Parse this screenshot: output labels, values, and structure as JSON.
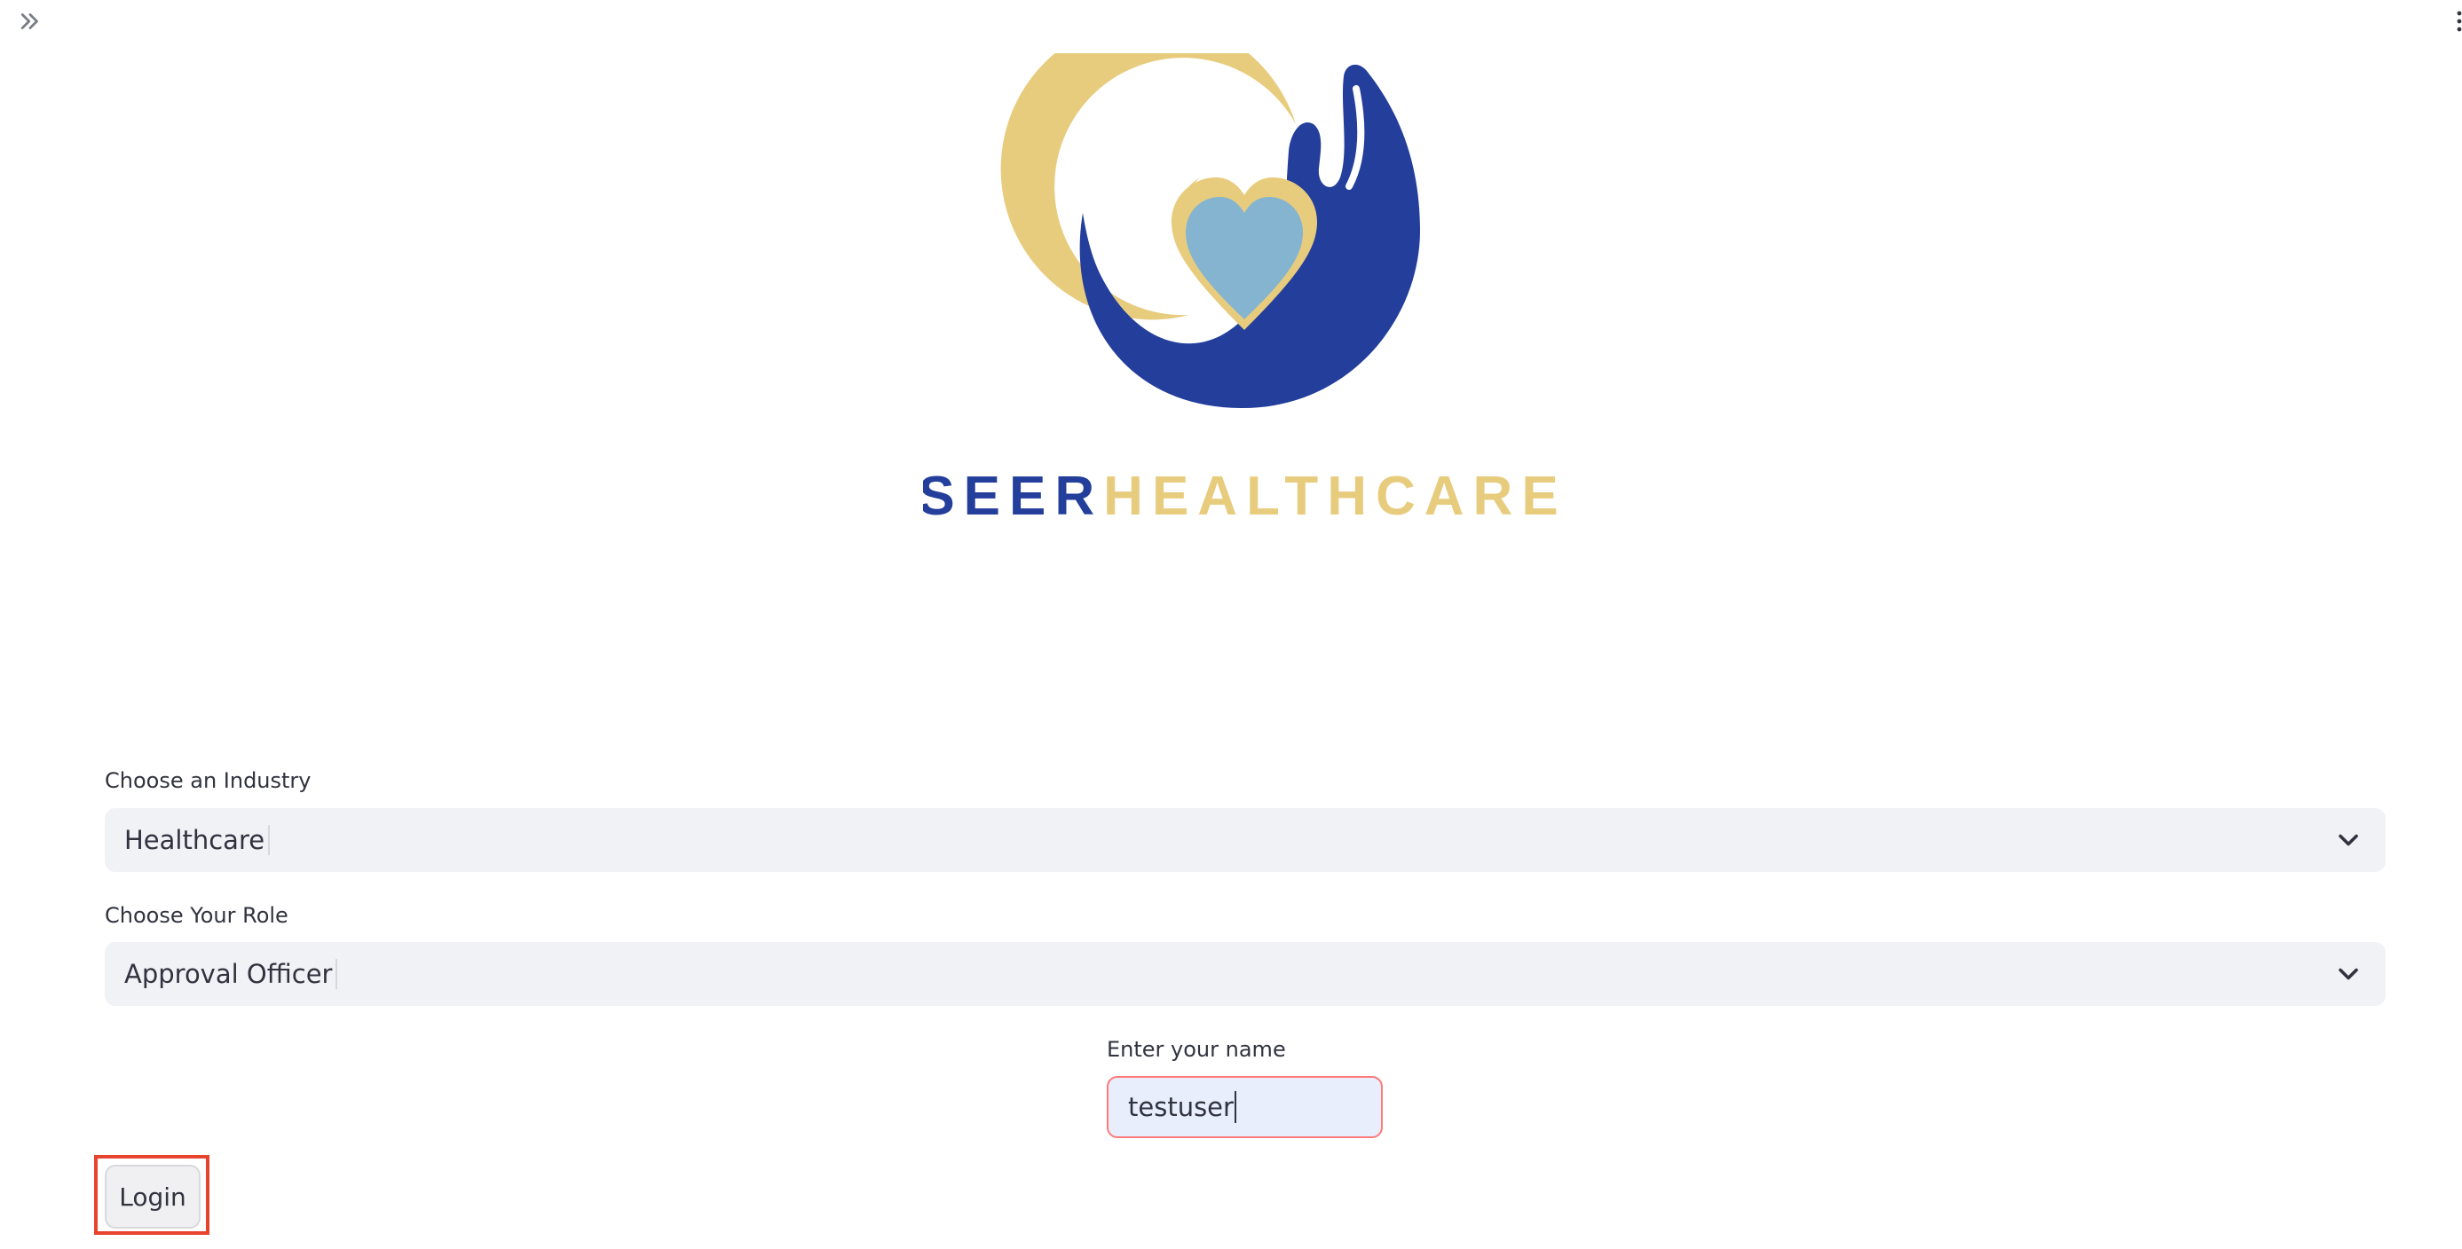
{
  "toolbar": {
    "expand_icon": "chevrons-right-icon",
    "menu_icon": "vertical-dots-icon"
  },
  "logo": {
    "brand_part1": "SEER",
    "brand_part2": "HEALTHCARE",
    "colors": {
      "primary_blue": "#233e9b",
      "gold": "#e8cc7e",
      "light_blue_heart": "#84b4d0"
    }
  },
  "form": {
    "industry": {
      "label": "Choose an Industry",
      "value": "Healthcare",
      "icon": "chevron-down-icon"
    },
    "role": {
      "label": "Choose Your Role",
      "value": "Approval Officer",
      "icon": "chevron-down-icon"
    },
    "name": {
      "label": "Enter your name",
      "value": "testuser"
    },
    "login_label": "Login"
  },
  "colors": {
    "select_bg": "#f0f2f6",
    "input_focus_border": "#ff7a7a",
    "input_bg": "#e8eefb",
    "highlight_border": "#e8432e",
    "text": "#31333f"
  }
}
